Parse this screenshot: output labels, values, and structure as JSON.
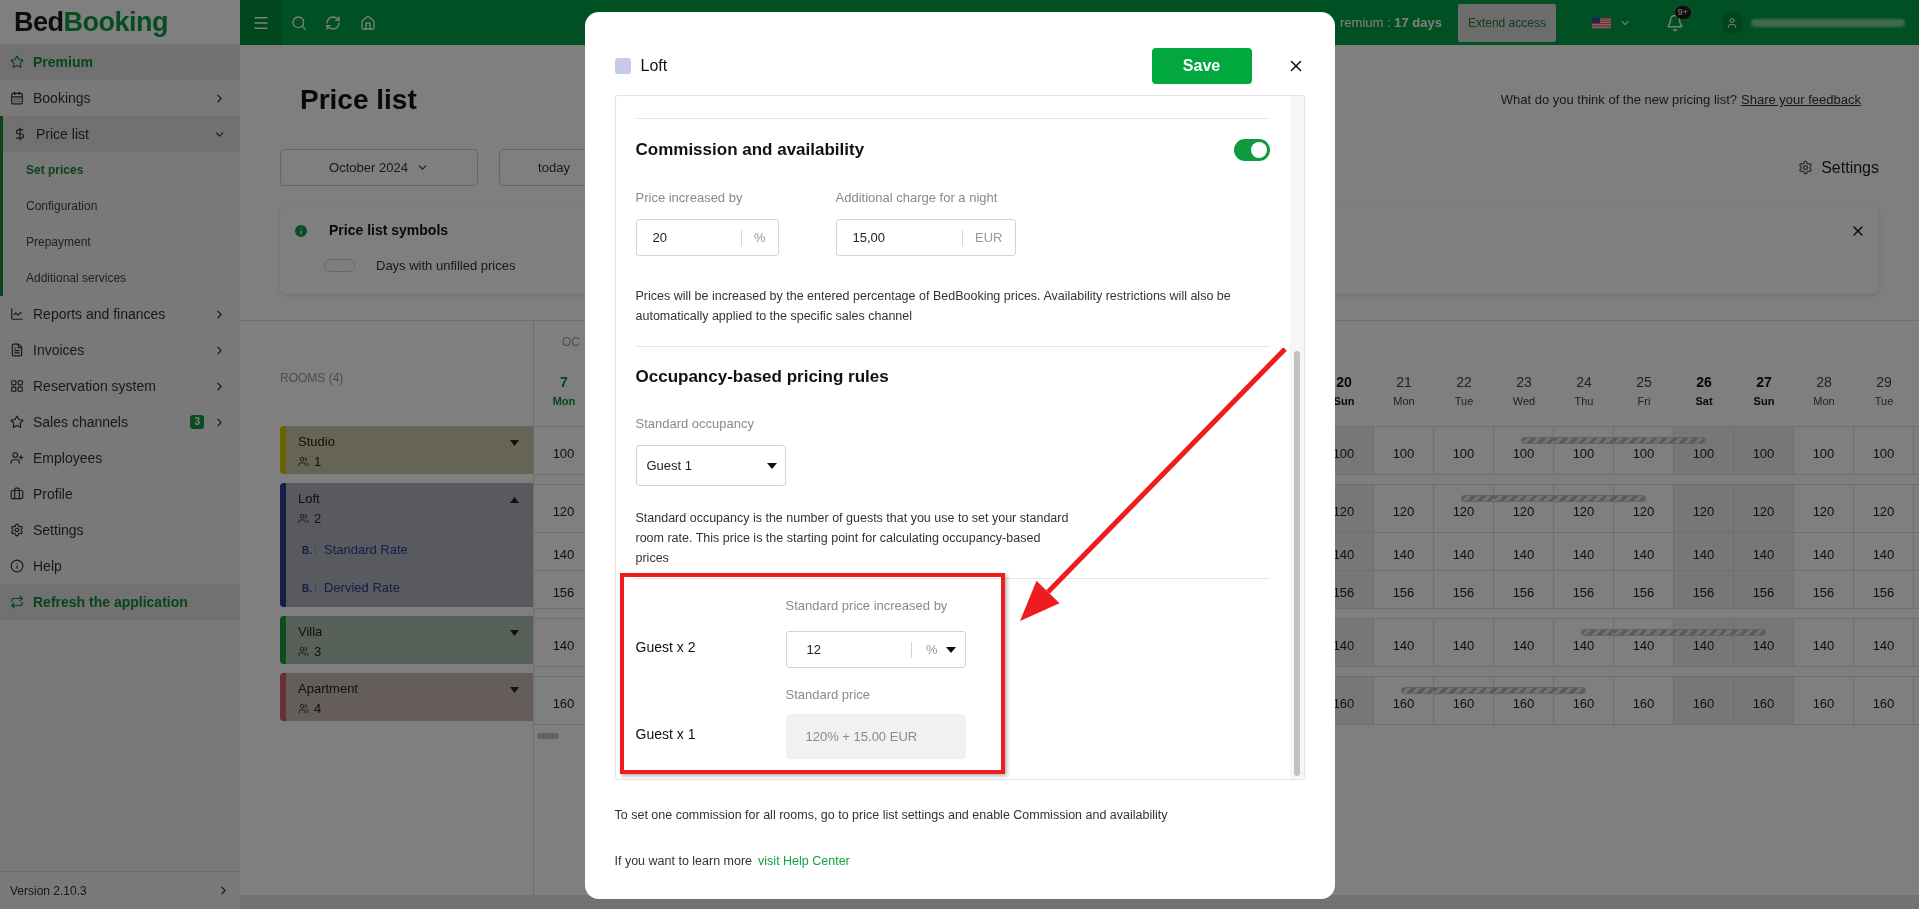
{
  "sidebar": {
    "logo": {
      "first": "Bed",
      "second": "Booking"
    },
    "items": [
      {
        "label": "Premium",
        "kind": "highlight"
      },
      {
        "label": "Bookings",
        "kind": "nav",
        "expanded": false
      },
      {
        "label": "Price list",
        "kind": "nav",
        "expanded": true,
        "children": [
          {
            "label": "Set prices",
            "selected": true
          },
          {
            "label": "Configuration",
            "selected": false
          },
          {
            "label": "Prepayment",
            "selected": false
          },
          {
            "label": "Additional services",
            "selected": false
          }
        ]
      },
      {
        "label": "Reports and finances",
        "kind": "nav",
        "expanded": false
      },
      {
        "label": "Invoices",
        "kind": "nav",
        "expanded": false
      },
      {
        "label": "Reservation system",
        "kind": "nav",
        "expanded": false
      },
      {
        "label": "Sales channels",
        "kind": "nav",
        "expanded": false,
        "badge": "3"
      },
      {
        "label": "Employees",
        "kind": "nav"
      },
      {
        "label": "Profile",
        "kind": "nav"
      },
      {
        "label": "Settings",
        "kind": "nav"
      },
      {
        "label": "Help",
        "kind": "nav"
      },
      {
        "label": "Refresh the application",
        "kind": "highlight"
      }
    ],
    "version": "Version 2.10.3"
  },
  "topbar": {
    "premium": "remium : **17 days**",
    "extend": "Extend access",
    "notifications": "9+"
  },
  "page": {
    "title": "Price list",
    "feedback": {
      "text": "What do you think of the new pricing list?",
      "link": "Share your feedback"
    },
    "month": "October 2024",
    "today": "today",
    "settings": "Settings",
    "symbols": {
      "title": "Price list symbols",
      "items": [
        "Days with unfilled prices"
      ]
    }
  },
  "calendar": {
    "rooms_label": "ROOMS (4)",
    "month": "OC",
    "days": [
      {
        "number": "7",
        "name": "Mon",
        "today": true,
        "weekend": false
      },
      {
        "number": "20",
        "name": "Sun",
        "today": false,
        "weekend": true
      },
      {
        "number": "21",
        "name": "Mon",
        "today": false,
        "weekend": false
      },
      {
        "number": "22",
        "name": "Tue",
        "today": false,
        "weekend": false
      },
      {
        "number": "23",
        "name": "Wed",
        "today": false,
        "weekend": false
      },
      {
        "number": "24",
        "name": "Thu",
        "today": false,
        "weekend": false
      },
      {
        "number": "25",
        "name": "Fri",
        "today": false,
        "weekend": false
      },
      {
        "number": "26",
        "name": "Sat",
        "today": false,
        "weekend": true
      },
      {
        "number": "27",
        "name": "Sun",
        "today": false,
        "weekend": true
      },
      {
        "number": "28",
        "name": "Mon",
        "today": false,
        "weekend": false
      },
      {
        "number": "29",
        "name": "Tue",
        "today": false,
        "weekend": false
      }
    ],
    "rooms": [
      {
        "name": "Studio",
        "guests": "1",
        "color": "#6a6200",
        "expanded": false,
        "cells": [
          {
            "value": "100",
            "bar": false
          },
          {
            "value": "100",
            "bar": false
          },
          {
            "value": "100",
            "bar": false
          },
          {
            "value": "100",
            "bar": false
          },
          {
            "value": "100",
            "bar": true
          },
          {
            "value": "100",
            "bar": true
          },
          {
            "value": "100",
            "bar": true
          },
          {
            "value": "100",
            "bar": true
          },
          {
            "value": "100",
            "bar": false
          },
          {
            "value": "100",
            "bar": false
          },
          {
            "value": "100",
            "bar": false
          }
        ]
      },
      {
        "name": "Loft",
        "guests": "2",
        "color": "#171d46",
        "expanded": true,
        "cells": [
          {
            "value": "120",
            "bar": false
          },
          {
            "value": "120",
            "bar": false
          },
          {
            "value": "120",
            "bar": false
          },
          {
            "value": "120",
            "bar": true
          },
          {
            "value": "120",
            "bar": true
          },
          {
            "value": "120",
            "bar": true
          },
          {
            "value": "120",
            "bar": true
          },
          {
            "value": "120",
            "bar": false
          },
          {
            "value": "120",
            "bar": false
          },
          {
            "value": "120",
            "bar": false
          },
          {
            "value": "120",
            "bar": false
          }
        ],
        "rates": [
          {
            "badge": "B.",
            "name": "Standard Rate",
            "cells": [
              {
                "value": "140",
                "bar": false
              },
              {
                "value": "140",
                "bar": false
              },
              {
                "value": "140",
                "bar": false
              },
              {
                "value": "140",
                "bar": false
              },
              {
                "value": "140",
                "bar": false
              },
              {
                "value": "140",
                "bar": false
              },
              {
                "value": "140",
                "bar": false
              },
              {
                "value": "140",
                "bar": false
              },
              {
                "value": "140",
                "bar": false
              },
              {
                "value": "140",
                "bar": false
              },
              {
                "value": "140",
                "bar": false
              }
            ]
          },
          {
            "badge": "B.",
            "name": "Dervied Rate",
            "cells": [
              {
                "value": "156",
                "bar": false
              },
              {
                "value": "156",
                "bar": false
              },
              {
                "value": "156",
                "bar": false
              },
              {
                "value": "156",
                "bar": false
              },
              {
                "value": "156",
                "bar": false
              },
              {
                "value": "156",
                "bar": false
              },
              {
                "value": "156",
                "bar": false
              },
              {
                "value": "156",
                "bar": false
              },
              {
                "value": "156",
                "bar": false
              },
              {
                "value": "156",
                "bar": false
              },
              {
                "value": "156",
                "bar": false
              }
            ]
          }
        ]
      },
      {
        "name": "Villa",
        "guests": "3",
        "color": "#0d4d1d",
        "expanded": false,
        "cells": [
          {
            "value": "140",
            "bar": false
          },
          {
            "value": "140",
            "bar": false
          },
          {
            "value": "140",
            "bar": false
          },
          {
            "value": "140",
            "bar": false
          },
          {
            "value": "140",
            "bar": false
          },
          {
            "value": "140",
            "bar": true
          },
          {
            "value": "140",
            "bar": true
          },
          {
            "value": "140",
            "bar": true
          },
          {
            "value": "140",
            "bar": true
          },
          {
            "value": "140",
            "bar": false
          },
          {
            "value": "140",
            "bar": false
          }
        ]
      },
      {
        "name": "Apartment",
        "guests": "4",
        "color": "#683030",
        "expanded": false,
        "cells": [
          {
            "value": "160",
            "bar": false
          },
          {
            "value": "160",
            "bar": false
          },
          {
            "value": "160",
            "bar": true
          },
          {
            "value": "160",
            "bar": true
          },
          {
            "value": "160",
            "bar": true
          },
          {
            "value": "160",
            "bar": true
          },
          {
            "value": "160",
            "bar": false
          },
          {
            "value": "160",
            "bar": false
          },
          {
            "value": "160",
            "bar": false
          },
          {
            "value": "160",
            "bar": false
          },
          {
            "value": "160",
            "bar": false
          }
        ]
      }
    ]
  },
  "modal": {
    "room": "Loft",
    "color": "#c5cae9",
    "save": "Save",
    "commission": {
      "title": "Commission and availability",
      "on": true,
      "fields": [
        {
          "label": "Price increased by",
          "value": "20",
          "unit": "%"
        },
        {
          "label": "Additional charge for a night",
          "value": "15,00",
          "unit": "EUR"
        }
      ],
      "note": "Prices will be increased by the entered percentage of BedBooking prices. Availability restrictions will also be automatically applied to the specific sales channel"
    },
    "occupancy": {
      "title": "Occupancy-based pricing rules",
      "standard_label": "Standard occupancy",
      "standard_value": "Guest 1",
      "note": "Standard occupancy is the number of guests that you use to set your standard room rate. This price is the starting point for calculating occupancy-based prices",
      "rows": [
        {
          "guest": "Guest x 2",
          "label": "Standard price increased by",
          "kind": "input",
          "value": "12",
          "unit": "%"
        },
        {
          "guest": "Guest x 1",
          "label": "Standard price",
          "kind": "readonly",
          "value": "120% + 15.00 EUR"
        }
      ]
    },
    "footer": "To set one commission for all rooms, go to price list settings and enable Commission and availability",
    "help": {
      "text": "If you want to learn more",
      "link": "visit Help Center"
    }
  }
}
